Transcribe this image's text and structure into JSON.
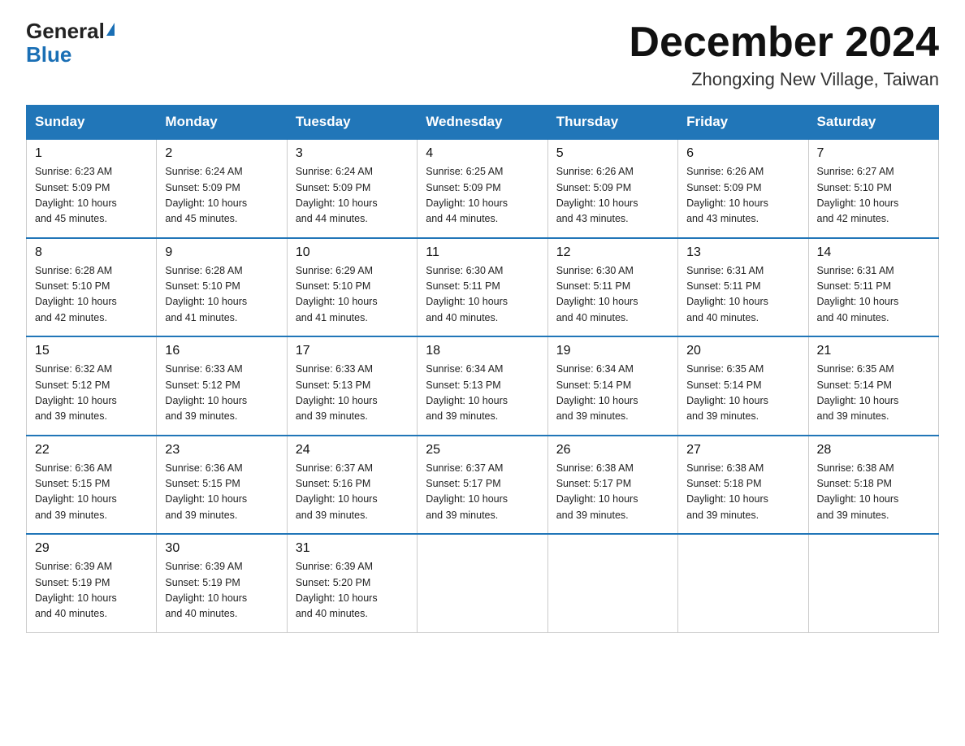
{
  "logo": {
    "general": "General",
    "blue": "Blue"
  },
  "header": {
    "month": "December 2024",
    "location": "Zhongxing New Village, Taiwan"
  },
  "weekdays": [
    "Sunday",
    "Monday",
    "Tuesday",
    "Wednesday",
    "Thursday",
    "Friday",
    "Saturday"
  ],
  "weeks": [
    [
      {
        "day": "1",
        "sunrise": "6:23 AM",
        "sunset": "5:09 PM",
        "daylight": "10 hours and 45 minutes."
      },
      {
        "day": "2",
        "sunrise": "6:24 AM",
        "sunset": "5:09 PM",
        "daylight": "10 hours and 45 minutes."
      },
      {
        "day": "3",
        "sunrise": "6:24 AM",
        "sunset": "5:09 PM",
        "daylight": "10 hours and 44 minutes."
      },
      {
        "day": "4",
        "sunrise": "6:25 AM",
        "sunset": "5:09 PM",
        "daylight": "10 hours and 44 minutes."
      },
      {
        "day": "5",
        "sunrise": "6:26 AM",
        "sunset": "5:09 PM",
        "daylight": "10 hours and 43 minutes."
      },
      {
        "day": "6",
        "sunrise": "6:26 AM",
        "sunset": "5:09 PM",
        "daylight": "10 hours and 43 minutes."
      },
      {
        "day": "7",
        "sunrise": "6:27 AM",
        "sunset": "5:10 PM",
        "daylight": "10 hours and 42 minutes."
      }
    ],
    [
      {
        "day": "8",
        "sunrise": "6:28 AM",
        "sunset": "5:10 PM",
        "daylight": "10 hours and 42 minutes."
      },
      {
        "day": "9",
        "sunrise": "6:28 AM",
        "sunset": "5:10 PM",
        "daylight": "10 hours and 41 minutes."
      },
      {
        "day": "10",
        "sunrise": "6:29 AM",
        "sunset": "5:10 PM",
        "daylight": "10 hours and 41 minutes."
      },
      {
        "day": "11",
        "sunrise": "6:30 AM",
        "sunset": "5:11 PM",
        "daylight": "10 hours and 40 minutes."
      },
      {
        "day": "12",
        "sunrise": "6:30 AM",
        "sunset": "5:11 PM",
        "daylight": "10 hours and 40 minutes."
      },
      {
        "day": "13",
        "sunrise": "6:31 AM",
        "sunset": "5:11 PM",
        "daylight": "10 hours and 40 minutes."
      },
      {
        "day": "14",
        "sunrise": "6:31 AM",
        "sunset": "5:11 PM",
        "daylight": "10 hours and 40 minutes."
      }
    ],
    [
      {
        "day": "15",
        "sunrise": "6:32 AM",
        "sunset": "5:12 PM",
        "daylight": "10 hours and 39 minutes."
      },
      {
        "day": "16",
        "sunrise": "6:33 AM",
        "sunset": "5:12 PM",
        "daylight": "10 hours and 39 minutes."
      },
      {
        "day": "17",
        "sunrise": "6:33 AM",
        "sunset": "5:13 PM",
        "daylight": "10 hours and 39 minutes."
      },
      {
        "day": "18",
        "sunrise": "6:34 AM",
        "sunset": "5:13 PM",
        "daylight": "10 hours and 39 minutes."
      },
      {
        "day": "19",
        "sunrise": "6:34 AM",
        "sunset": "5:14 PM",
        "daylight": "10 hours and 39 minutes."
      },
      {
        "day": "20",
        "sunrise": "6:35 AM",
        "sunset": "5:14 PM",
        "daylight": "10 hours and 39 minutes."
      },
      {
        "day": "21",
        "sunrise": "6:35 AM",
        "sunset": "5:14 PM",
        "daylight": "10 hours and 39 minutes."
      }
    ],
    [
      {
        "day": "22",
        "sunrise": "6:36 AM",
        "sunset": "5:15 PM",
        "daylight": "10 hours and 39 minutes."
      },
      {
        "day": "23",
        "sunrise": "6:36 AM",
        "sunset": "5:15 PM",
        "daylight": "10 hours and 39 minutes."
      },
      {
        "day": "24",
        "sunrise": "6:37 AM",
        "sunset": "5:16 PM",
        "daylight": "10 hours and 39 minutes."
      },
      {
        "day": "25",
        "sunrise": "6:37 AM",
        "sunset": "5:17 PM",
        "daylight": "10 hours and 39 minutes."
      },
      {
        "day": "26",
        "sunrise": "6:38 AM",
        "sunset": "5:17 PM",
        "daylight": "10 hours and 39 minutes."
      },
      {
        "day": "27",
        "sunrise": "6:38 AM",
        "sunset": "5:18 PM",
        "daylight": "10 hours and 39 minutes."
      },
      {
        "day": "28",
        "sunrise": "6:38 AM",
        "sunset": "5:18 PM",
        "daylight": "10 hours and 39 minutes."
      }
    ],
    [
      {
        "day": "29",
        "sunrise": "6:39 AM",
        "sunset": "5:19 PM",
        "daylight": "10 hours and 40 minutes."
      },
      {
        "day": "30",
        "sunrise": "6:39 AM",
        "sunset": "5:19 PM",
        "daylight": "10 hours and 40 minutes."
      },
      {
        "day": "31",
        "sunrise": "6:39 AM",
        "sunset": "5:20 PM",
        "daylight": "10 hours and 40 minutes."
      },
      null,
      null,
      null,
      null
    ]
  ],
  "labels": {
    "sunrise": "Sunrise:",
    "sunset": "Sunset:",
    "daylight": "Daylight:"
  }
}
